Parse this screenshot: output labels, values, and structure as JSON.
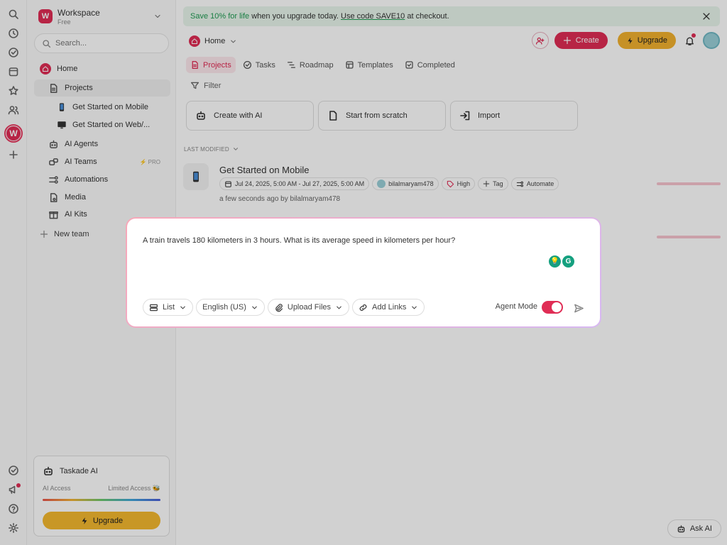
{
  "banner": {
    "green_text": "Save 10% for life",
    "text1": " when you upgrade today. ",
    "code_text": "Use code SAVE10",
    "text2": " at checkout."
  },
  "workspace": {
    "name": "Workspace",
    "plan": "Free",
    "logo": "W"
  },
  "search": {
    "placeholder": "Search..."
  },
  "sidebar": {
    "home": "Home",
    "projects": "Projects",
    "proj_mobile": "Get Started on Mobile",
    "proj_web": "Get Started on Web/...",
    "ai_agents": "AI Agents",
    "ai_teams": "AI Teams",
    "pro_badge": "PRO",
    "automations": "Automations",
    "media": "Media",
    "ai_kits": "AI Kits",
    "new_team": "New team"
  },
  "ai_card": {
    "title": "Taskade AI",
    "access_label": "AI Access",
    "access_value": "Limited Access",
    "upgrade": "Upgrade"
  },
  "header": {
    "breadcrumb": "Home",
    "create": "Create",
    "upgrade": "Upgrade"
  },
  "tabs": [
    "Projects",
    "Tasks",
    "Roadmap",
    "Templates",
    "Completed"
  ],
  "filter": "Filter",
  "cards": {
    "create_ai": "Create with AI",
    "scratch": "Start from scratch",
    "import": "Import"
  },
  "list": {
    "heading": "LAST MODIFIED",
    "project": {
      "title": "Get Started on Mobile",
      "dates": "Jul 24, 2025, 5:00 AM - Jul 27, 2025, 5:00 AM",
      "user": "bilalmaryam478",
      "priority": "High",
      "tag": "Tag",
      "automate": "Automate",
      "meta": "a few seconds ago by bilalmaryam478"
    }
  },
  "ask_ai": "Ask AI",
  "modal": {
    "prompt": "A train travels 180 kilometers in 3 hours. What is its average speed in kilometers per hour?",
    "opt_list": "List",
    "opt_lang": "English (US)",
    "opt_upload": "Upload Files",
    "opt_links": "Add Links",
    "agent_mode": "Agent Mode"
  },
  "colors": {
    "accent": "#e02d55",
    "upgrade": "#f2b12f",
    "banner_bg": "#e8f6ec"
  }
}
